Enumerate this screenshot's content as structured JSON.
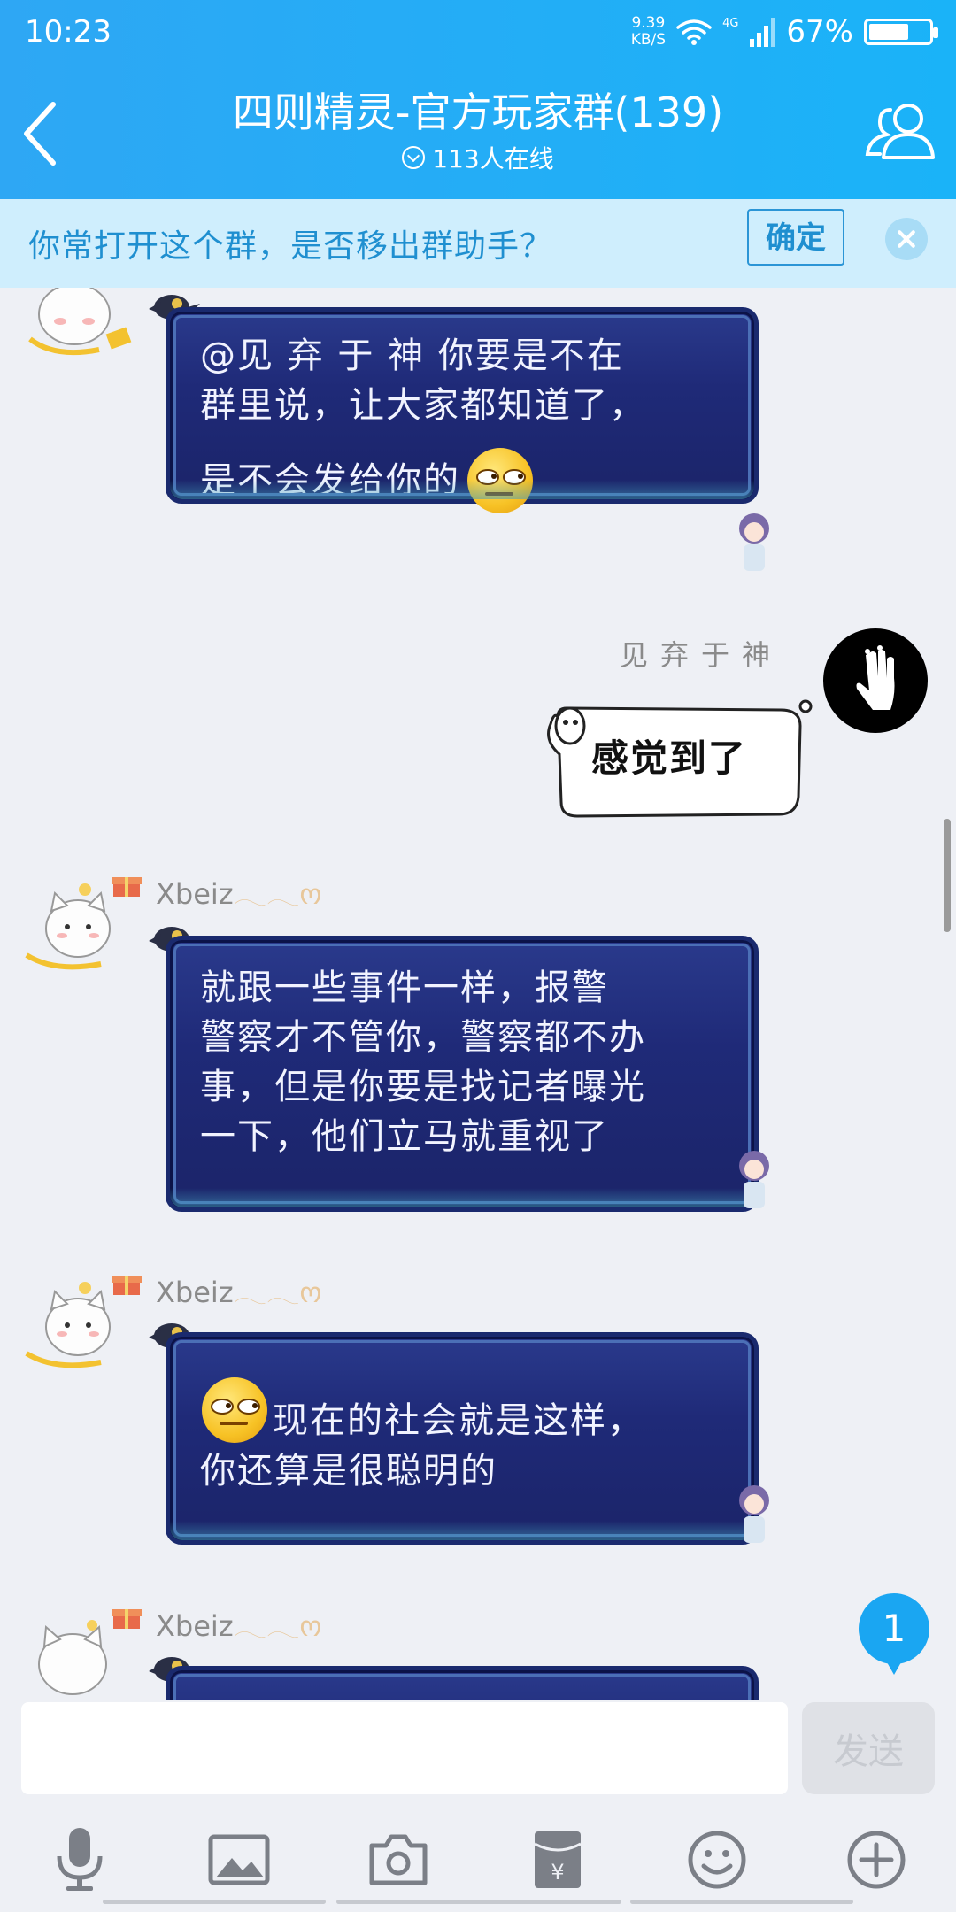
{
  "status_bar": {
    "time": "10:23",
    "net_speed_value": "9.39",
    "net_speed_unit": "KB/S",
    "network_type": "4G",
    "battery_percent": "67%",
    "battery_level": 0.67
  },
  "header": {
    "title": "四则精灵-官方玩家群(139)",
    "online": "113人在线"
  },
  "notice": {
    "text": "你常打开这个群，是否移出群助手？",
    "confirm_label": "确定"
  },
  "messages": [
    {
      "side": "left",
      "lines": [
        "@见 弃 于 神 你要是不在",
        "群里说，让大家都知道了，",
        "是不会发给你的"
      ],
      "emoji": "smirk-emoji"
    },
    {
      "side": "right",
      "sender": "见弃于神",
      "text": "感觉到了"
    },
    {
      "side": "left",
      "sender": "Xbeiz",
      "sender_decor": "𓂃𓂃ო",
      "lines": [
        "就跟一些事件一样，报警",
        "警察才不管你，警察都不办",
        "事，但是你要是找记者曝光",
        "一下，他们立马就重视了"
      ]
    },
    {
      "side": "left",
      "sender": "Xbeiz",
      "sender_decor": "𓂃𓂃ო",
      "emoji": "smirk-emoji",
      "lines": [
        "现在的社会就是这样，",
        "你还算是很聪明的"
      ]
    },
    {
      "side": "left",
      "sender": "Xbeiz",
      "sender_decor": "𓂃𓂃ო",
      "lines": []
    }
  ],
  "unread_count": "1",
  "input": {
    "value": "",
    "send_label": "发送"
  },
  "toolbar": [
    "microphone-icon",
    "image-icon",
    "camera-icon",
    "red-packet-icon",
    "emoji-icon",
    "plus-icon"
  ],
  "colors": {
    "header": "#1ab3f8",
    "notice_bg": "#cfeefd",
    "bubble": "#1f2a78",
    "badge": "#1aa6f2"
  }
}
